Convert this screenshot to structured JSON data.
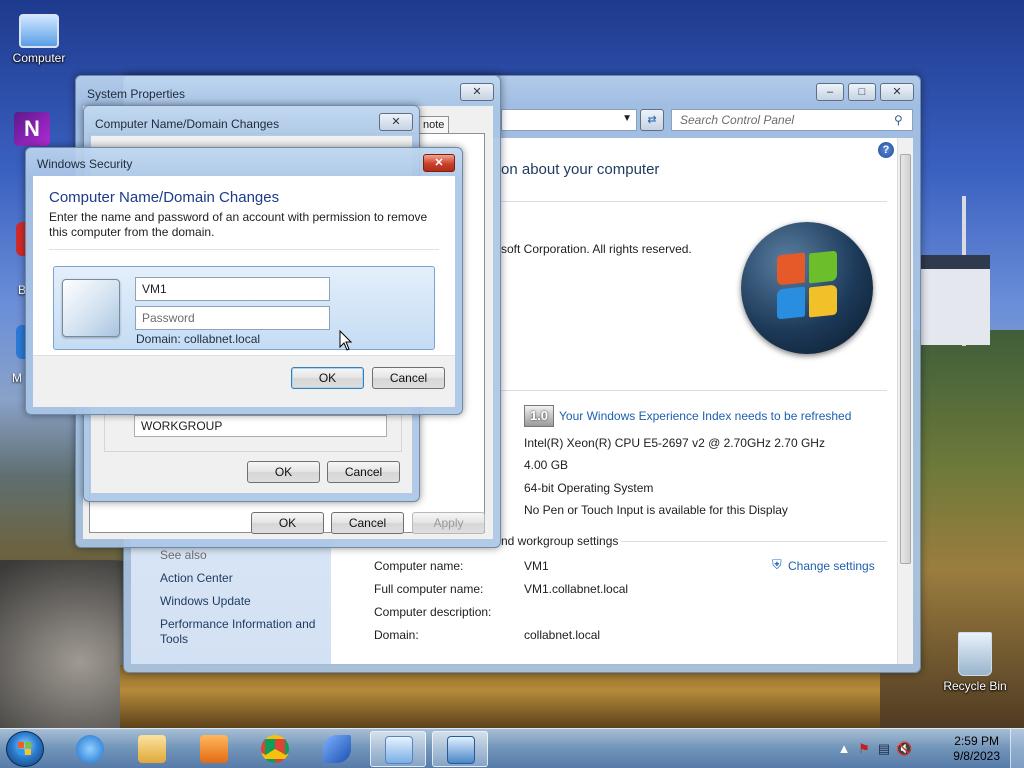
{
  "desktop": {
    "icons": [
      {
        "label": "Computer"
      },
      {
        "label": "Recycle Bin"
      }
    ],
    "partial_labels": [
      "B",
      "M"
    ]
  },
  "control_panel": {
    "search_placeholder": "Search Control Panel",
    "heading": "on about your computer",
    "copyright": "soft Corporation.  All rights reserved.",
    "rating_score": "1.0",
    "rating_link": "Your Windows Experience Index needs to be refreshed",
    "processor": "Intel(R) Xeon(R) CPU E5-2697 v2 @ 2.70GHz  2.70 GHz",
    "memory": "4.00 GB",
    "system_type": "64-bit Operating System",
    "pen_touch": "No Pen or Touch Input is available for this Display",
    "section_computer_name": "nd workgroup settings",
    "labels": {
      "computer_name": "Computer name:",
      "full_computer_name": "Full computer name:",
      "computer_description": "Computer description:",
      "domain": "Domain:"
    },
    "values": {
      "computer_name": "VM1",
      "full_computer_name": "VM1.collabnet.local",
      "domain": "collabnet.local"
    },
    "change_settings": "Change settings",
    "see_also": "See also",
    "left_links": [
      "Action Center",
      "Windows Update",
      "Performance Information and Tools"
    ]
  },
  "system_properties": {
    "title": "System Properties",
    "tab_partial": "note",
    "ok": "OK",
    "cancel": "Cancel",
    "apply": "Apply"
  },
  "name_changes": {
    "title": "Computer Name/Domain Changes",
    "workgroup_value": "WORKGROUP",
    "ok": "OK",
    "cancel": "Cancel"
  },
  "windows_security": {
    "title": "Windows Security",
    "heading": "Computer Name/Domain Changes",
    "description": "Enter the name and password of an account with permission to remove this computer from the domain.",
    "username_value": "VM1",
    "password_placeholder": "Password",
    "domain_line": "Domain: collabnet.local",
    "ok": "OK",
    "cancel": "Cancel"
  },
  "taskbar": {
    "time": "2:59 PM",
    "date": "9/8/2023"
  },
  "icons": {
    "start": "windows-start-orb",
    "taskbar_items": [
      "internet-explorer-icon",
      "file-explorer-icon",
      "media-player-icon",
      "chrome-icon",
      "sail-app-icon",
      "control-panel-icon",
      "system-properties-icon"
    ],
    "tray": [
      "action-center-flag-icon",
      "network-icon",
      "volume-muted-icon"
    ]
  },
  "colors": {
    "link": "#1d5fad",
    "close_red": "#c9402a",
    "default_button_border": "#3c7fb1"
  }
}
